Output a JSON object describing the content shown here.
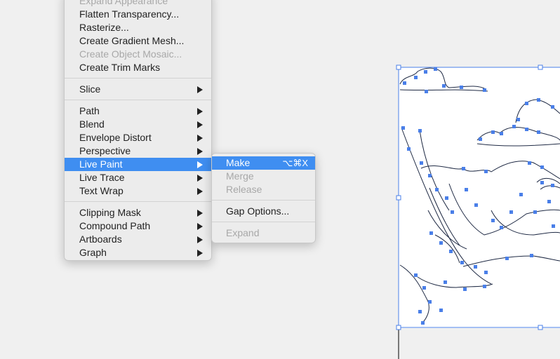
{
  "main_menu": {
    "items_a": [
      {
        "label": "Expand Appearance",
        "disabled": true
      },
      {
        "label": "Flatten Transparency...",
        "disabled": false
      },
      {
        "label": "Rasterize...",
        "disabled": false
      },
      {
        "label": "Create Gradient Mesh...",
        "disabled": false
      },
      {
        "label": "Create Object Mosaic...",
        "disabled": true
      },
      {
        "label": "Create Trim Marks",
        "disabled": false
      }
    ],
    "items_b": [
      {
        "label": "Slice",
        "submenu": true
      }
    ],
    "items_c": [
      {
        "label": "Path",
        "submenu": true
      },
      {
        "label": "Blend",
        "submenu": true
      },
      {
        "label": "Envelope Distort",
        "submenu": true
      },
      {
        "label": "Perspective",
        "submenu": true
      },
      {
        "label": "Live Paint",
        "submenu": true,
        "highlighted": true
      },
      {
        "label": "Live Trace",
        "submenu": true
      },
      {
        "label": "Text Wrap",
        "submenu": true
      }
    ],
    "items_d": [
      {
        "label": "Clipping Mask",
        "submenu": true
      },
      {
        "label": "Compound Path",
        "submenu": true
      },
      {
        "label": "Artboards",
        "submenu": true
      },
      {
        "label": "Graph",
        "submenu": true
      }
    ]
  },
  "live_paint_submenu": {
    "make": {
      "label": "Make",
      "shortcut": "⌥⌘X"
    },
    "merge": {
      "label": "Merge"
    },
    "release": {
      "label": "Release"
    },
    "gap_options": {
      "label": "Gap Options..."
    },
    "expand": {
      "label": "Expand"
    }
  },
  "colors": {
    "highlight": "#3f8ef1",
    "selection": "#4a7fe8",
    "path_stroke": "#1f2a44"
  }
}
